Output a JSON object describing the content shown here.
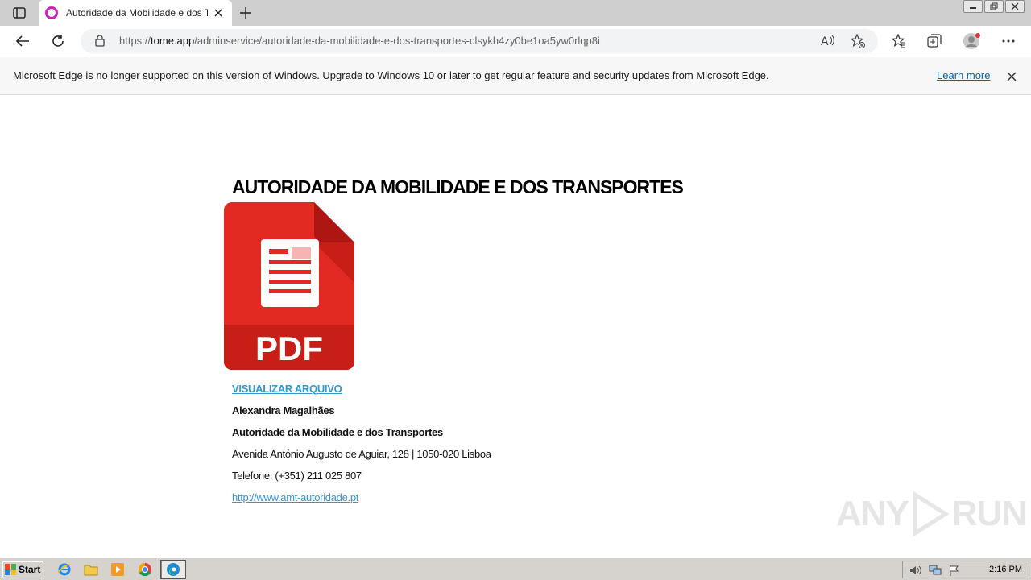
{
  "browser": {
    "tab_title": "Autoridade da Mobilidade e dos Tr",
    "url_prefix": "https://",
    "url_host": "tome.app",
    "url_path": "/adminservice/autoridade-da-mobilidade-e-dos-transportes-clsykh4zy0be1oa5yw0rlqp8i"
  },
  "infobar": {
    "message": "Microsoft Edge is no longer supported on this version of Windows. Upgrade to Windows 10 or later to get regular feature and security updates from Microsoft Edge.",
    "link": "Learn more"
  },
  "page": {
    "heading": "AUTORIDADE DA MOBILIDADE E DOS TRANSPORTES",
    "pdf_label": "PDF",
    "view_link": "VISUALIZAR ARQUIVO",
    "name": "Alexandra Magalhães",
    "org": "Autoridade da Mobilidade e dos Transportes",
    "address": "Avenida António Augusto de Aguiar, 128 | 1050-020 Lisboa",
    "phone": "Telefone: (+351) 211 025 807",
    "website": "http://www.amt-autoridade.pt"
  },
  "watermark": {
    "left": "ANY",
    "right": "RUN"
  },
  "taskbar": {
    "start_label": "Start",
    "clock": "2:16 PM"
  },
  "colors": {
    "pdf_red": "#e22a22",
    "link_blue": "#2e9ad0",
    "edge_link": "#0066b4"
  }
}
